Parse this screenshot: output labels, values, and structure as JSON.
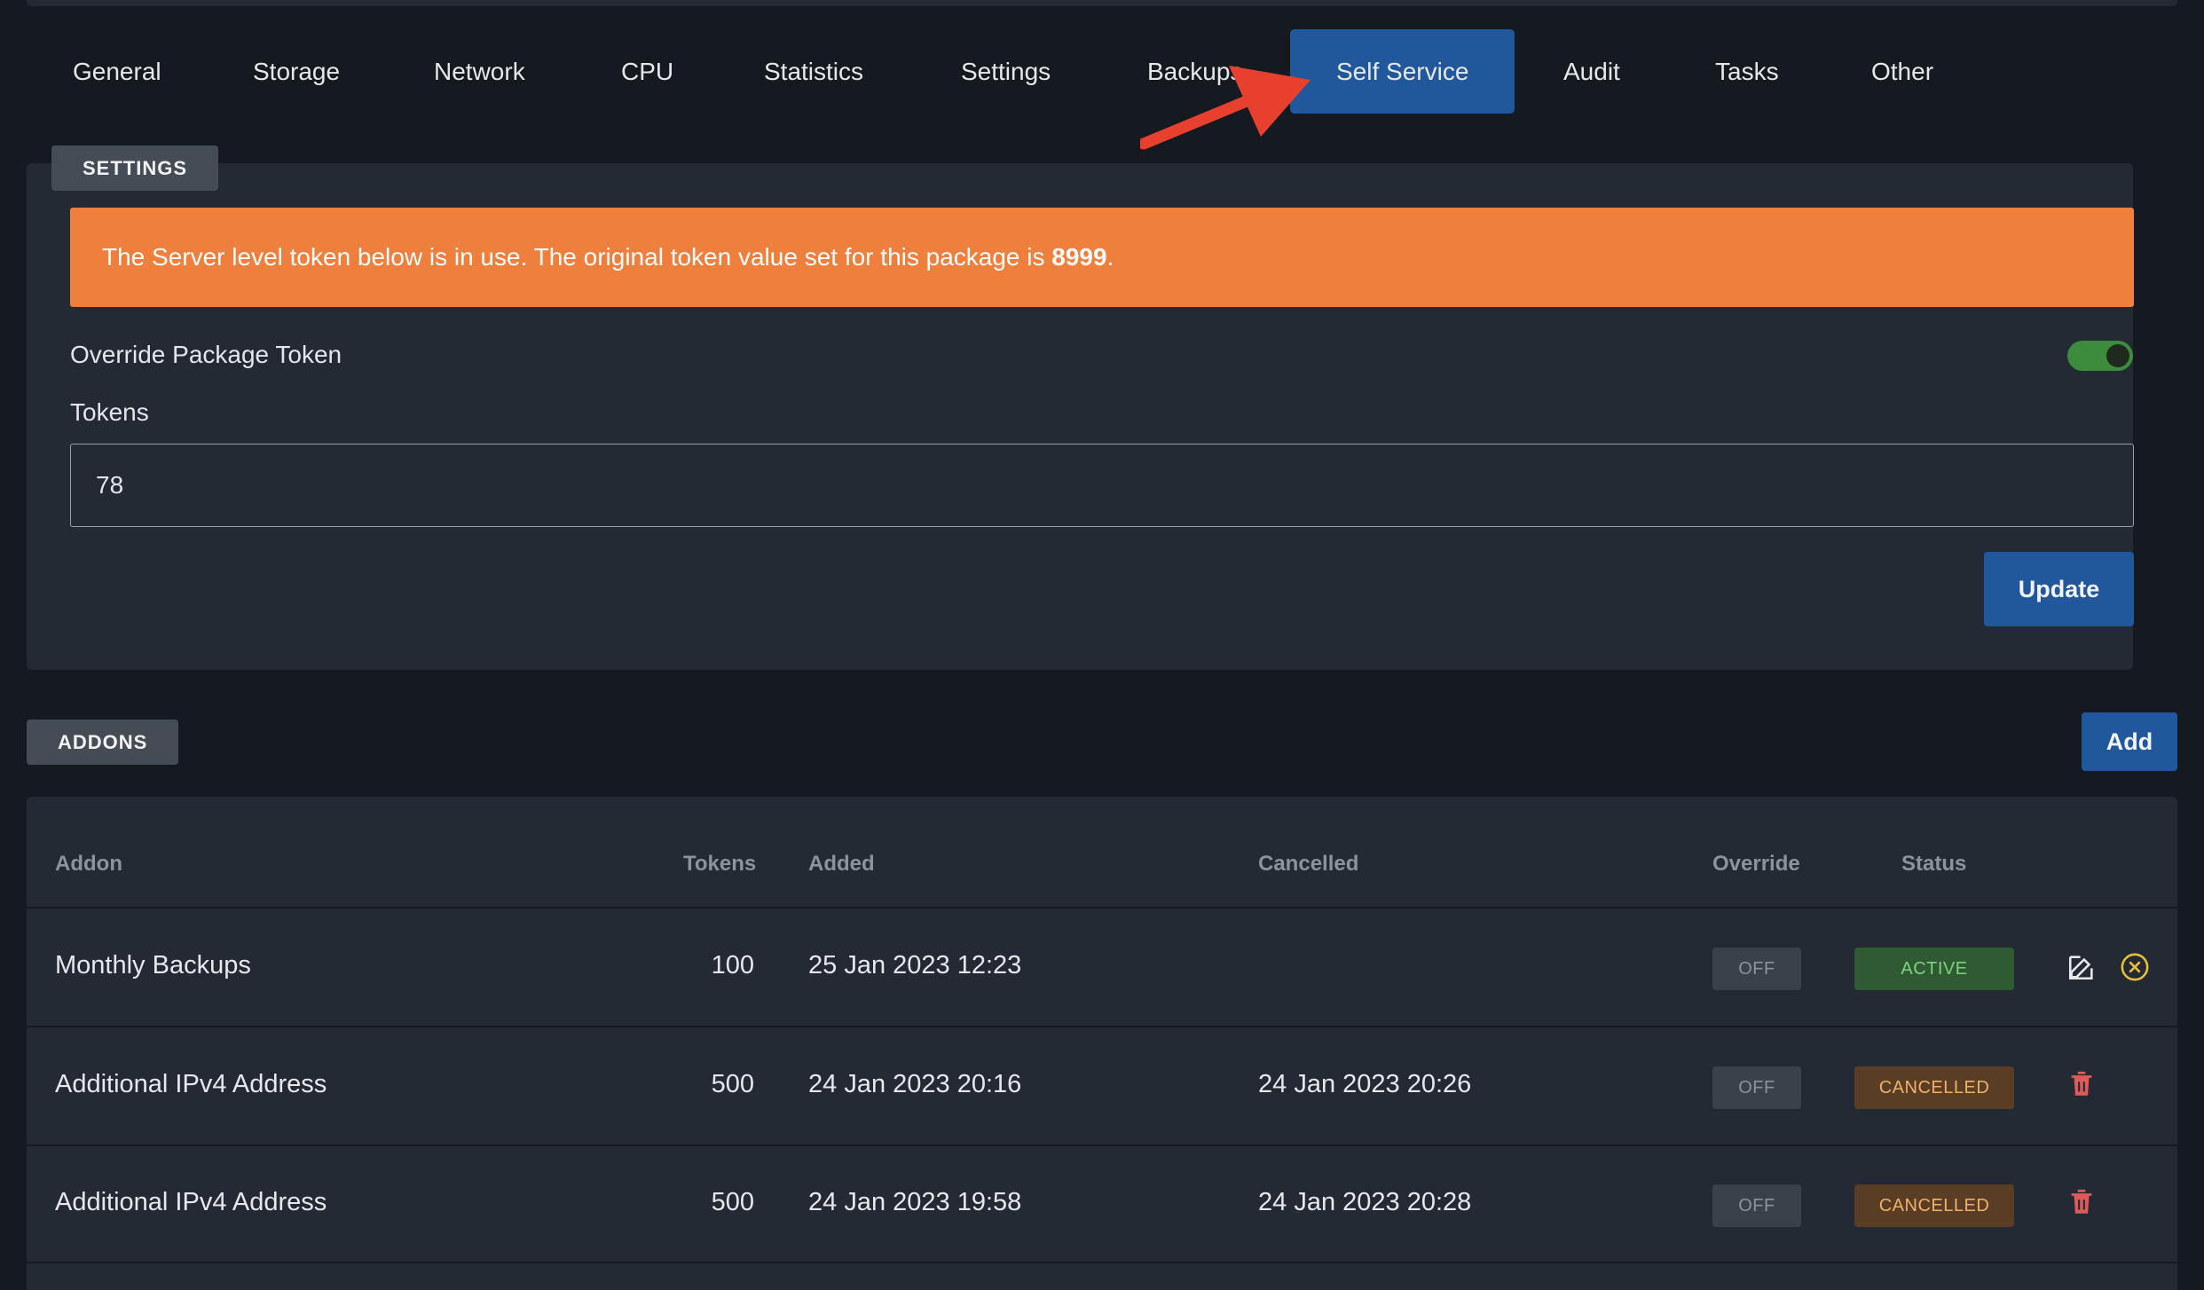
{
  "tabs": [
    {
      "label": "General"
    },
    {
      "label": "Storage"
    },
    {
      "label": "Network"
    },
    {
      "label": "CPU"
    },
    {
      "label": "Statistics"
    },
    {
      "label": "Settings"
    },
    {
      "label": "Backups"
    },
    {
      "label": "Self Service",
      "active": true
    },
    {
      "label": "Audit"
    },
    {
      "label": "Tasks"
    },
    {
      "label": "Other"
    }
  ],
  "settings": {
    "section_label": "SETTINGS",
    "alert_text": "The Server level token below is in use. The original token value set for this package is ",
    "alert_value": "8999",
    "alert_suffix": ".",
    "override_label": "Override Package Token",
    "override_enabled": true,
    "tokens_label": "Tokens",
    "tokens_value": "78",
    "update_label": "Update"
  },
  "addons": {
    "section_label": "ADDONS",
    "add_label": "Add",
    "columns": [
      "Addon",
      "Tokens",
      "Added",
      "Cancelled",
      "Override",
      "Status"
    ],
    "rows": [
      {
        "addon": "Monthly Backups",
        "tokens": "100",
        "added": "25 Jan 2023 12:23",
        "cancelled": "",
        "override": "OFF",
        "status": "ACTIVE"
      },
      {
        "addon": "Additional IPv4 Address",
        "tokens": "500",
        "added": "24 Jan 2023 20:16",
        "cancelled": "24 Jan 2023 20:26",
        "override": "OFF",
        "status": "CANCELLED"
      },
      {
        "addon": "Additional IPv4 Address",
        "tokens": "500",
        "added": "24 Jan 2023 19:58",
        "cancelled": "24 Jan 2023 20:28",
        "override": "OFF",
        "status": "CANCELLED"
      }
    ]
  },
  "colors": {
    "accent": "#21589b",
    "alert": "#ef7f3d",
    "toggle_on": "#3d8b3d",
    "delete": "#e05a5a",
    "cancel_icon": "#e8c13a"
  }
}
